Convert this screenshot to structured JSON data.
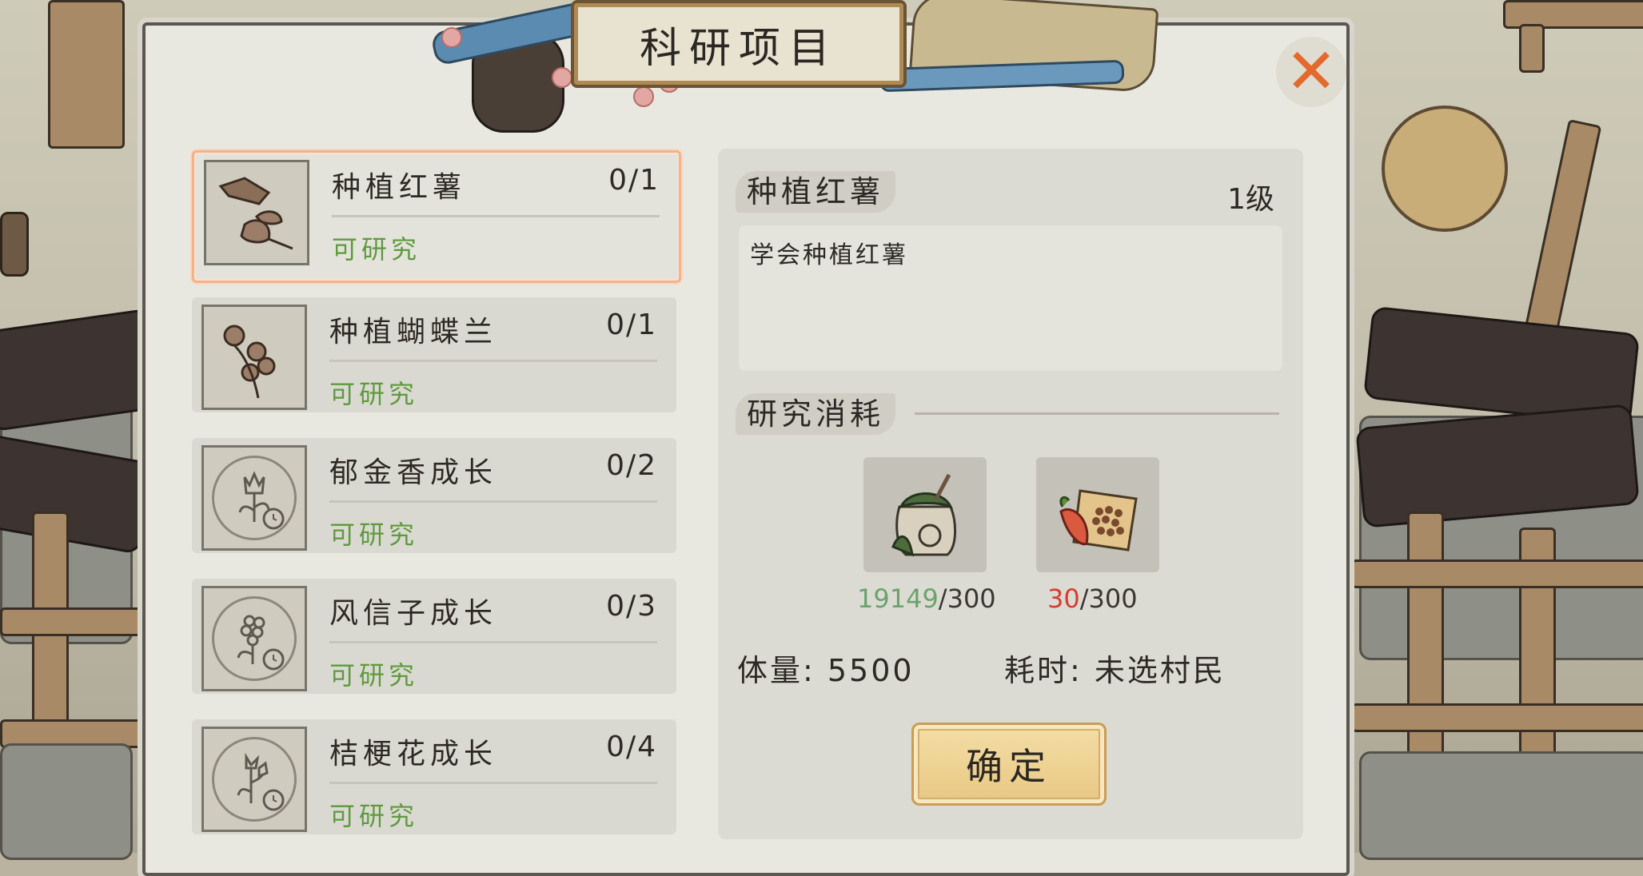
{
  "dialog": {
    "title": "科研项目",
    "close_icon": "close-x-icon",
    "accent_color": "#e36a2c"
  },
  "research_list": [
    {
      "name": "种植红薯",
      "progress": "0/1",
      "status": "可研究",
      "icon": "sweet-potato-icon",
      "selected": true
    },
    {
      "name": "种植蝴蝶兰",
      "progress": "0/1",
      "status": "可研究",
      "icon": "orchid-icon",
      "selected": false
    },
    {
      "name": "郁金香成长",
      "progress": "0/2",
      "status": "可研究",
      "icon": "tulip-clock-icon",
      "selected": false
    },
    {
      "name": "风信子成长",
      "progress": "0/3",
      "status": "可研究",
      "icon": "hyacinth-clock-icon",
      "selected": false
    },
    {
      "name": "桔梗花成长",
      "progress": "0/4",
      "status": "可研究",
      "icon": "bellflower-clock-icon",
      "selected": false
    }
  ],
  "detail": {
    "name": "种植红薯",
    "level": "1级",
    "description": "学会种植红薯",
    "cost_header": "研究消耗",
    "costs": [
      {
        "icon": "seed-bag-icon",
        "have": "19149",
        "need": "/300",
        "sufficient": true
      },
      {
        "icon": "sweet-potato-seeds-icon",
        "have": "30",
        "need": "/300",
        "sufficient": false
      }
    ],
    "stamina": "体量: 5500",
    "duration": "耗时: 未选村民",
    "confirm_label": "确定"
  },
  "colors": {
    "status_green": "#5e9a3d",
    "enough_green": "#6aa36b",
    "lack_red": "#d83b30",
    "selection_border": "#f0b38c",
    "button_gold": "#e9c783"
  }
}
